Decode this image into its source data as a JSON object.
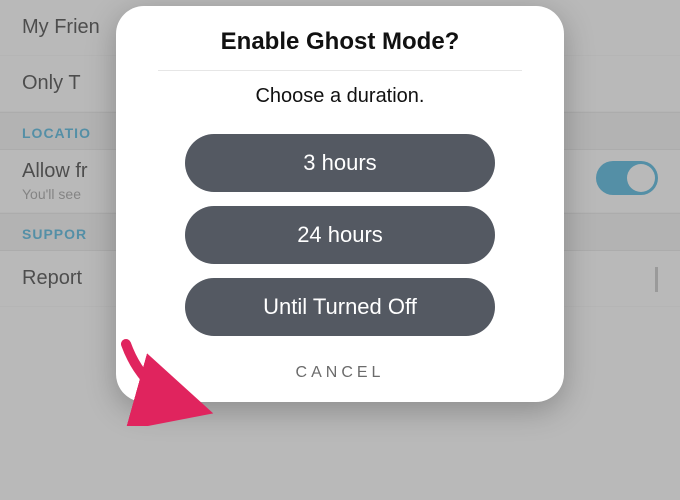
{
  "background": {
    "rows": {
      "my_friends": "My Frien",
      "only_these": "Only T",
      "allow_friends": "Allow fr",
      "allow_friends_sub": "You'll see",
      "report": "Report"
    },
    "sections": {
      "location": "LOCATIO",
      "support": "SUPPOR"
    },
    "toggle_on": true
  },
  "modal": {
    "title": "Enable Ghost Mode?",
    "subtitle": "Choose a duration.",
    "options": {
      "opt1": "3 hours",
      "opt2": "24 hours",
      "opt3": "Until Turned Off"
    },
    "cancel": "CANCEL"
  },
  "annotation": {
    "arrow_color": "#e0245e"
  }
}
